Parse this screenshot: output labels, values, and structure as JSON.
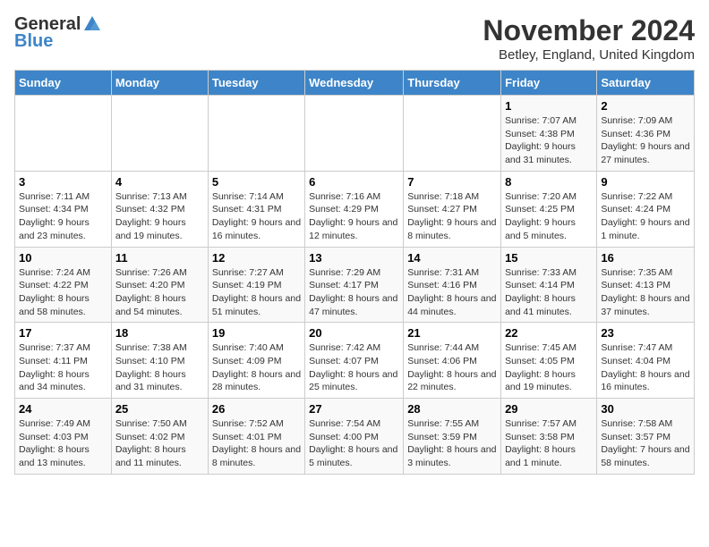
{
  "header": {
    "logo_general": "General",
    "logo_blue": "Blue",
    "month_title": "November 2024",
    "location": "Betley, England, United Kingdom"
  },
  "days_of_week": [
    "Sunday",
    "Monday",
    "Tuesday",
    "Wednesday",
    "Thursday",
    "Friday",
    "Saturday"
  ],
  "weeks": [
    [
      {
        "day": "",
        "info": ""
      },
      {
        "day": "",
        "info": ""
      },
      {
        "day": "",
        "info": ""
      },
      {
        "day": "",
        "info": ""
      },
      {
        "day": "",
        "info": ""
      },
      {
        "day": "1",
        "info": "Sunrise: 7:07 AM\nSunset: 4:38 PM\nDaylight: 9 hours\nand 31 minutes."
      },
      {
        "day": "2",
        "info": "Sunrise: 7:09 AM\nSunset: 4:36 PM\nDaylight: 9 hours\nand 27 minutes."
      }
    ],
    [
      {
        "day": "3",
        "info": "Sunrise: 7:11 AM\nSunset: 4:34 PM\nDaylight: 9 hours\nand 23 minutes."
      },
      {
        "day": "4",
        "info": "Sunrise: 7:13 AM\nSunset: 4:32 PM\nDaylight: 9 hours\nand 19 minutes."
      },
      {
        "day": "5",
        "info": "Sunrise: 7:14 AM\nSunset: 4:31 PM\nDaylight: 9 hours\nand 16 minutes."
      },
      {
        "day": "6",
        "info": "Sunrise: 7:16 AM\nSunset: 4:29 PM\nDaylight: 9 hours\nand 12 minutes."
      },
      {
        "day": "7",
        "info": "Sunrise: 7:18 AM\nSunset: 4:27 PM\nDaylight: 9 hours\nand 8 minutes."
      },
      {
        "day": "8",
        "info": "Sunrise: 7:20 AM\nSunset: 4:25 PM\nDaylight: 9 hours\nand 5 minutes."
      },
      {
        "day": "9",
        "info": "Sunrise: 7:22 AM\nSunset: 4:24 PM\nDaylight: 9 hours\nand 1 minute."
      }
    ],
    [
      {
        "day": "10",
        "info": "Sunrise: 7:24 AM\nSunset: 4:22 PM\nDaylight: 8 hours\nand 58 minutes."
      },
      {
        "day": "11",
        "info": "Sunrise: 7:26 AM\nSunset: 4:20 PM\nDaylight: 8 hours\nand 54 minutes."
      },
      {
        "day": "12",
        "info": "Sunrise: 7:27 AM\nSunset: 4:19 PM\nDaylight: 8 hours\nand 51 minutes."
      },
      {
        "day": "13",
        "info": "Sunrise: 7:29 AM\nSunset: 4:17 PM\nDaylight: 8 hours\nand 47 minutes."
      },
      {
        "day": "14",
        "info": "Sunrise: 7:31 AM\nSunset: 4:16 PM\nDaylight: 8 hours\nand 44 minutes."
      },
      {
        "day": "15",
        "info": "Sunrise: 7:33 AM\nSunset: 4:14 PM\nDaylight: 8 hours\nand 41 minutes."
      },
      {
        "day": "16",
        "info": "Sunrise: 7:35 AM\nSunset: 4:13 PM\nDaylight: 8 hours\nand 37 minutes."
      }
    ],
    [
      {
        "day": "17",
        "info": "Sunrise: 7:37 AM\nSunset: 4:11 PM\nDaylight: 8 hours\nand 34 minutes."
      },
      {
        "day": "18",
        "info": "Sunrise: 7:38 AM\nSunset: 4:10 PM\nDaylight: 8 hours\nand 31 minutes."
      },
      {
        "day": "19",
        "info": "Sunrise: 7:40 AM\nSunset: 4:09 PM\nDaylight: 8 hours\nand 28 minutes."
      },
      {
        "day": "20",
        "info": "Sunrise: 7:42 AM\nSunset: 4:07 PM\nDaylight: 8 hours\nand 25 minutes."
      },
      {
        "day": "21",
        "info": "Sunrise: 7:44 AM\nSunset: 4:06 PM\nDaylight: 8 hours\nand 22 minutes."
      },
      {
        "day": "22",
        "info": "Sunrise: 7:45 AM\nSunset: 4:05 PM\nDaylight: 8 hours\nand 19 minutes."
      },
      {
        "day": "23",
        "info": "Sunrise: 7:47 AM\nSunset: 4:04 PM\nDaylight: 8 hours\nand 16 minutes."
      }
    ],
    [
      {
        "day": "24",
        "info": "Sunrise: 7:49 AM\nSunset: 4:03 PM\nDaylight: 8 hours\nand 13 minutes."
      },
      {
        "day": "25",
        "info": "Sunrise: 7:50 AM\nSunset: 4:02 PM\nDaylight: 8 hours\nand 11 minutes."
      },
      {
        "day": "26",
        "info": "Sunrise: 7:52 AM\nSunset: 4:01 PM\nDaylight: 8 hours\nand 8 minutes."
      },
      {
        "day": "27",
        "info": "Sunrise: 7:54 AM\nSunset: 4:00 PM\nDaylight: 8 hours\nand 5 minutes."
      },
      {
        "day": "28",
        "info": "Sunrise: 7:55 AM\nSunset: 3:59 PM\nDaylight: 8 hours\nand 3 minutes."
      },
      {
        "day": "29",
        "info": "Sunrise: 7:57 AM\nSunset: 3:58 PM\nDaylight: 8 hours\nand 1 minute."
      },
      {
        "day": "30",
        "info": "Sunrise: 7:58 AM\nSunset: 3:57 PM\nDaylight: 7 hours\nand 58 minutes."
      }
    ]
  ]
}
